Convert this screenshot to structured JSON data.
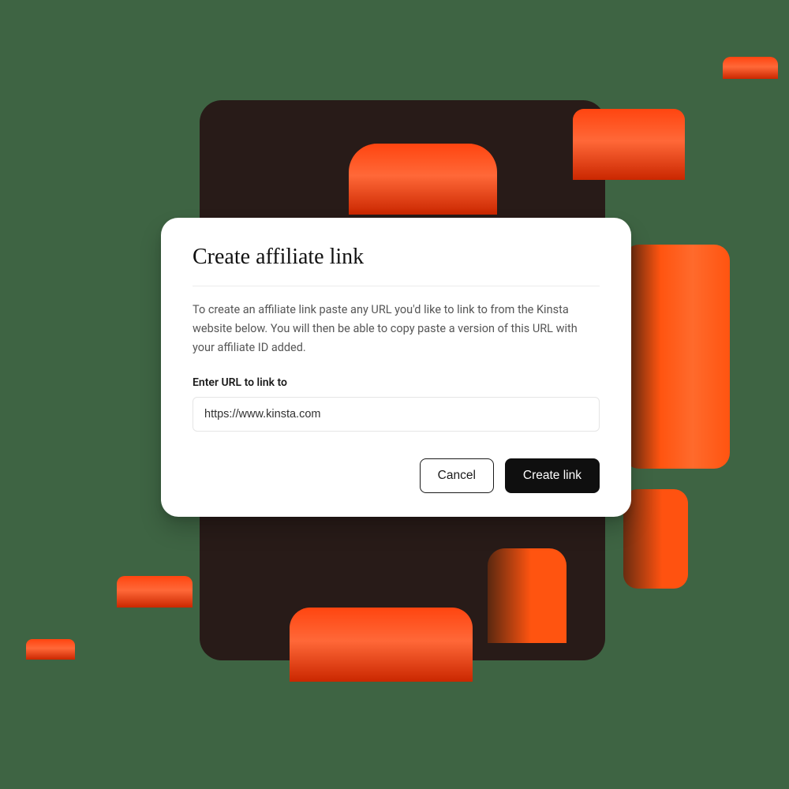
{
  "modal": {
    "title": "Create affiliate link",
    "description": "To create an affiliate link paste any URL you'd like to link to from the Kinsta website below. You will then be able to copy paste a version of this URL with your affiliate ID added.",
    "field_label": "Enter URL to link to",
    "url_value": "https://www.kinsta.com",
    "cancel_label": "Cancel",
    "submit_label": "Create link"
  }
}
